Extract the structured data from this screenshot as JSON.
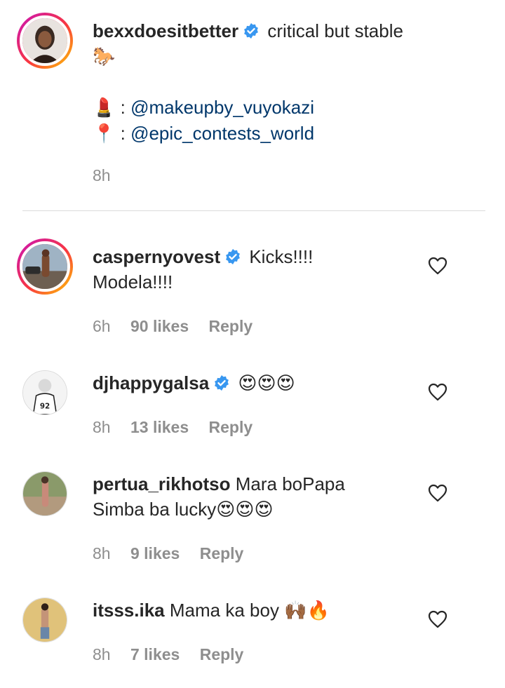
{
  "caption": {
    "username": "bexxdoesitbetter",
    "text": "critical but stable",
    "emoji_line": "🐎",
    "line_makeup_icon": "💄",
    "line_makeup_mention": "@makeupby_vuyokazi",
    "line_location_icon": "📍",
    "line_location_mention": "@epic_contests_world",
    "colon": ":",
    "time": "8h"
  },
  "comments": [
    {
      "username": "caspernyovest",
      "verified": true,
      "text_line1": "Kicks!!!!",
      "text_line2": "Modela!!!!",
      "time": "6h",
      "likes": "90 likes",
      "reply": "Reply"
    },
    {
      "username": "djhappygalsa",
      "verified": true,
      "text_line1": "😍😍😍",
      "time": "8h",
      "likes": "13 likes",
      "reply": "Reply"
    },
    {
      "username": "pertua_rikhotso",
      "verified": false,
      "text_line1": "Mara boPapa",
      "text_line2": "Simba ba lucky😍😍😍",
      "time": "8h",
      "likes": "9 likes",
      "reply": "Reply"
    },
    {
      "username": "itsss.ika",
      "verified": false,
      "text_line1": "Mama ka boy 🙌🏾🔥",
      "time": "8h",
      "likes": "7 likes",
      "reply": "Reply"
    }
  ],
  "icons": {
    "verified": "verified-badge-icon",
    "like": "heart-outline-icon"
  },
  "colors": {
    "verified_blue": "#3897f0",
    "mention": "#00376b",
    "meta_gray": "#8e8e8e"
  }
}
